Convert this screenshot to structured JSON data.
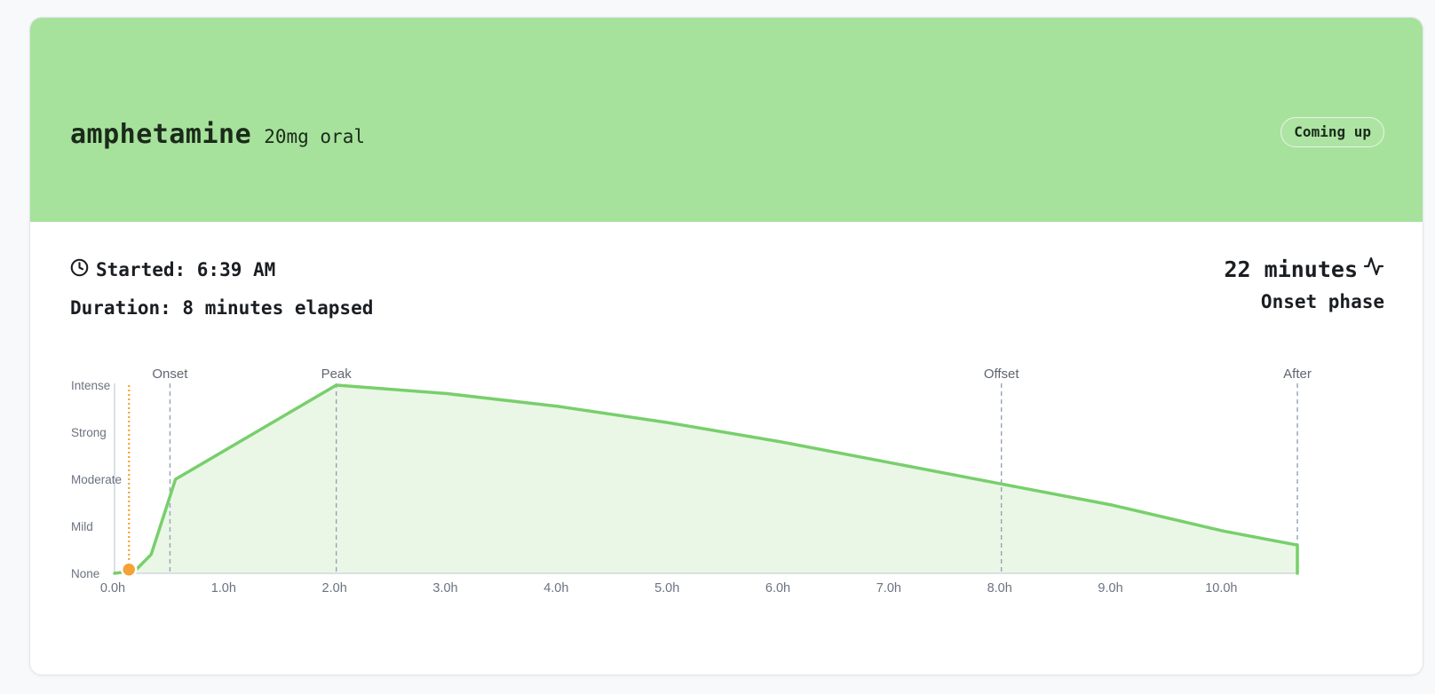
{
  "dose": {
    "substance": "amphetamine",
    "amount": "20mg",
    "route": "oral",
    "amount_route": "20mg oral",
    "status_badge": "Coming up"
  },
  "session": {
    "started_label": "Started: 6:39 AM",
    "duration_label": "Duration: 8 minutes elapsed",
    "remaining_label": "22 minutes",
    "phase_label": "Onset phase"
  },
  "icons": {
    "started": "clock-icon",
    "remaining": "activity-pulse-icon"
  },
  "colors": {
    "header_bg": "#a6e29c",
    "curve": "#78cf6c",
    "curve_fill": "#eaf7e6",
    "now_marker": "#f4a236",
    "phase_line": "#94a3b8",
    "axis_text": "#6b7280"
  },
  "chart_data": {
    "type": "area",
    "x": [
      0,
      0.1,
      0.2,
      0.33,
      0.55,
      2.0,
      3.0,
      4.0,
      5.0,
      6.0,
      7.0,
      8.0,
      9.0,
      10.0,
      10.67
    ],
    "y": [
      0,
      0.03,
      0.09,
      0.4,
      2.0,
      4.0,
      3.82,
      3.55,
      3.2,
      2.8,
      2.35,
      1.9,
      1.45,
      0.9,
      0.6,
      0
    ],
    "xlim": [
      0,
      10.67
    ],
    "ylim": [
      0,
      4
    ],
    "x_ticks": [
      0,
      1,
      2,
      3,
      4,
      5,
      6,
      7,
      8,
      9,
      10
    ],
    "x_tick_labels": [
      "0.0h",
      "1.0h",
      "2.0h",
      "3.0h",
      "4.0h",
      "5.0h",
      "6.0h",
      "7.0h",
      "8.0h",
      "9.0h",
      "10.0h"
    ],
    "y_tick_labels": [
      "None",
      "Mild",
      "Moderate",
      "Strong",
      "Intense"
    ],
    "phases": [
      {
        "label": "Onset",
        "x": 0.5
      },
      {
        "label": "Peak",
        "x": 2.0
      },
      {
        "label": "Offset",
        "x": 8.0
      },
      {
        "label": "After",
        "x": 10.67
      }
    ],
    "current_time": 0.13,
    "current_level": 0.08,
    "grid": false
  }
}
